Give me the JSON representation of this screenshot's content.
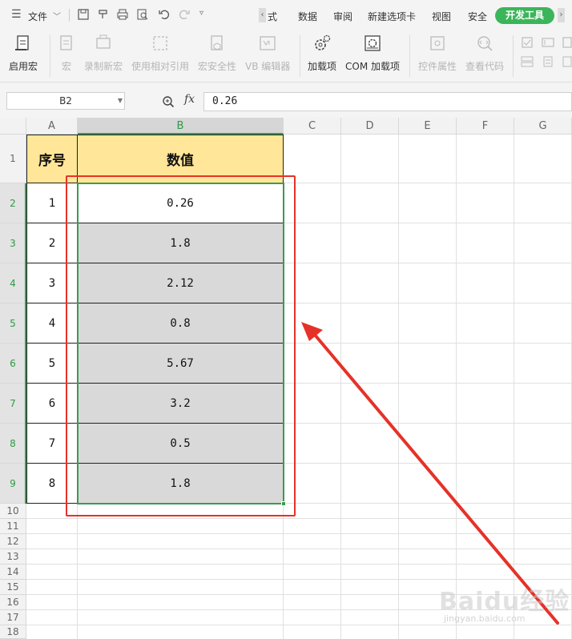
{
  "menu": {
    "file_label": "文件",
    "tabs": [
      "式",
      "数据",
      "审阅",
      "新建选项卡",
      "视图",
      "安全"
    ],
    "active_tab": "开发工具"
  },
  "ribbon": {
    "enable_macro": "启用宏",
    "macro": "宏",
    "record_macro": "录制新宏",
    "relative_ref": "使用相对引用",
    "macro_security": "宏安全性",
    "vb_editor": "VB 编辑器",
    "addins": "加载项",
    "com_addins": "COM 加载项",
    "control_props": "控件属性",
    "view_code": "查看代码"
  },
  "formula_bar": {
    "name_box": "B2",
    "fx_label": "fx",
    "value": "0.26"
  },
  "columns": [
    "A",
    "B",
    "C",
    "D",
    "E",
    "F",
    "G"
  ],
  "rows": [
    "1",
    "2",
    "3",
    "4",
    "5",
    "6",
    "7",
    "8",
    "9",
    "10",
    "11",
    "12",
    "13",
    "14",
    "15",
    "16",
    "17",
    "18"
  ],
  "table": {
    "headers": [
      "序号",
      "数值"
    ],
    "rows": [
      [
        "1",
        "0.26"
      ],
      [
        "2",
        "1.8"
      ],
      [
        "3",
        "2.12"
      ],
      [
        "4",
        "0.8"
      ],
      [
        "5",
        "5.67"
      ],
      [
        "6",
        "3.2"
      ],
      [
        "7",
        "0.5"
      ],
      [
        "8",
        "1.8"
      ]
    ]
  },
  "watermark": {
    "brand": "Baidu经验",
    "url": "jingyan.baidu.com"
  },
  "colors": {
    "accent_green": "#3cb55a",
    "header_fill": "#ffe699",
    "selected_fill": "#d9d9d9",
    "annotation_red": "#e53228",
    "selection_green": "#3a9b4e"
  }
}
